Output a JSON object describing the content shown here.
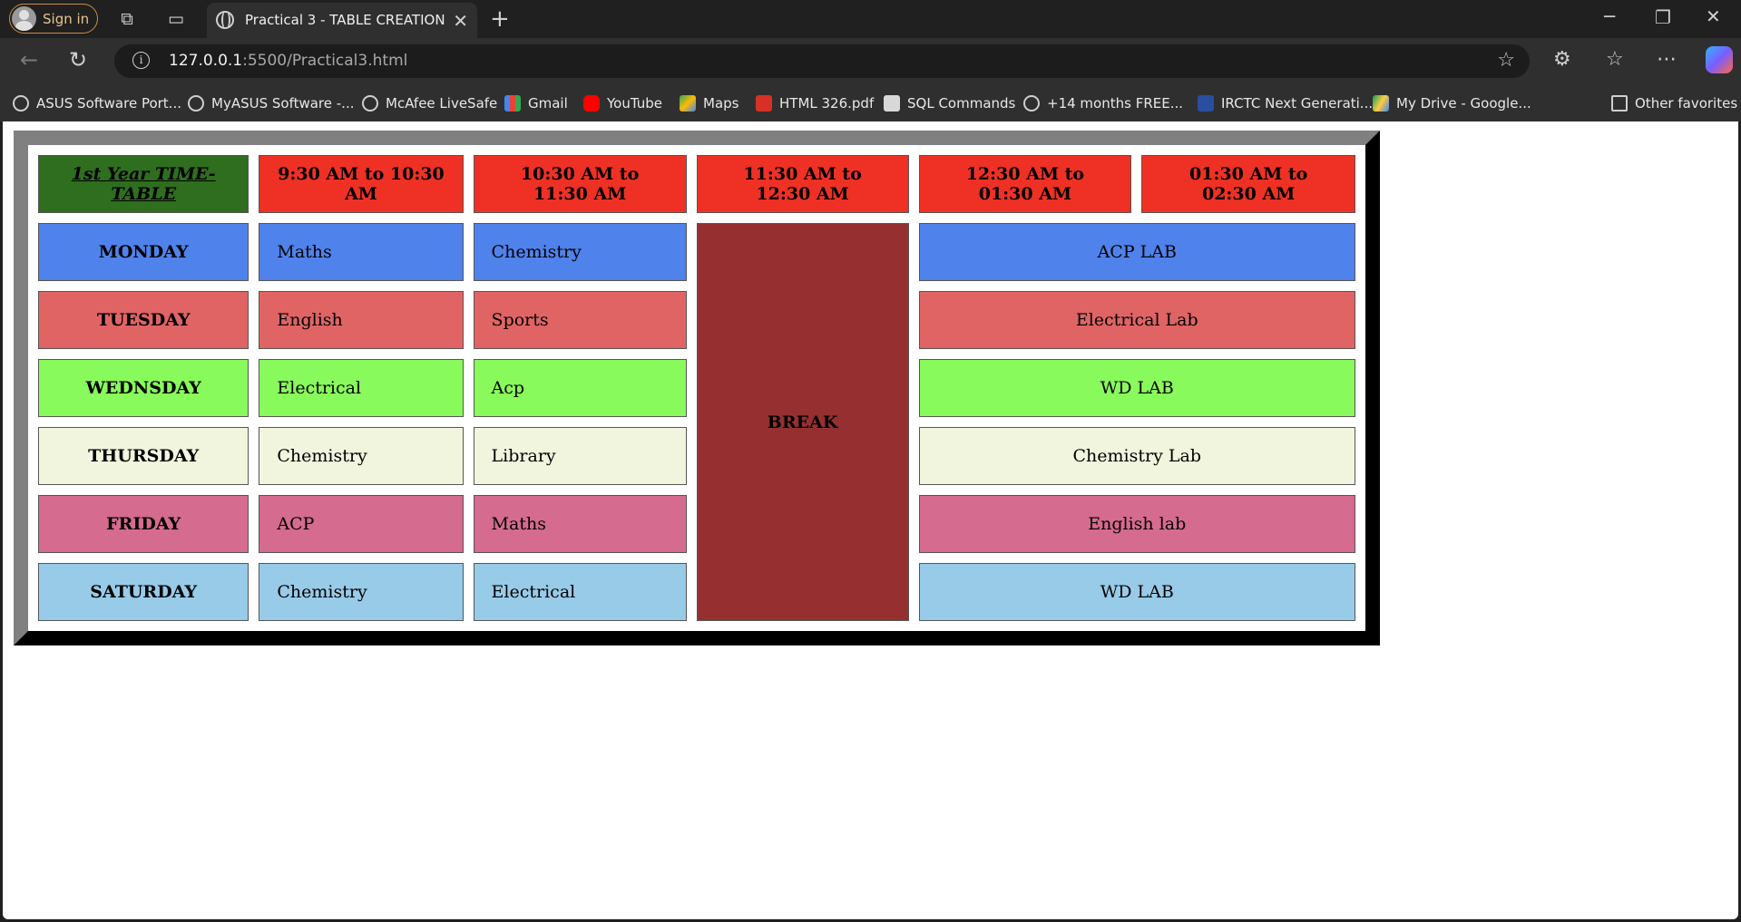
{
  "browser": {
    "signin_label": "Sign in",
    "tab_title": "Practical 3 - TABLE CREATION",
    "url_host": "127.0.0.1",
    "url_rest": ":5500/Practical3.html",
    "bookmarks": [
      {
        "label": "ASUS Software Port...",
        "icon": "globe-icon"
      },
      {
        "label": "MyASUS Software -...",
        "icon": "globe-icon"
      },
      {
        "label": "McAfee LiveSafe",
        "icon": "globe-icon"
      },
      {
        "label": "Gmail",
        "icon": "gmail-icon"
      },
      {
        "label": "YouTube",
        "icon": "youtube-icon"
      },
      {
        "label": "Maps",
        "icon": "maps-icon"
      },
      {
        "label": "HTML 326.pdf",
        "icon": "pdf-icon"
      },
      {
        "label": "SQL Commands",
        "icon": "page-icon"
      },
      {
        "label": "+14 months FREE...",
        "icon": "globe-icon"
      },
      {
        "label": "IRCTC Next Generati...",
        "icon": "irctc-icon"
      },
      {
        "label": "My Drive - Google...",
        "icon": "drive-icon"
      }
    ],
    "other_favorites": "Other favorites"
  },
  "timetable": {
    "corner": "1st Year TIME-TABLE",
    "slots": [
      "9:30 AM to 10:30 AM",
      "10:30 AM to 11:30 AM",
      "11:30 AM to 12:30 AM",
      "12:30 AM to 01:30 AM",
      "01:30 AM to 02:30 AM"
    ],
    "break_label": "BREAK",
    "days": [
      {
        "day": "MONDAY",
        "s1": "Maths",
        "s2": "Chemistry",
        "lab": "ACP LAB"
      },
      {
        "day": "TUESDAY",
        "s1": "English",
        "s2": "Sports",
        "lab": "Electrical Lab"
      },
      {
        "day": "WEDNSDAY",
        "s1": "Electrical",
        "s2": "Acp",
        "lab": "WD LAB"
      },
      {
        "day": "THURSDAY",
        "s1": "Chemistry",
        "s2": "Library",
        "lab": "Chemistry Lab"
      },
      {
        "day": "FRIDAY",
        "s1": "ACP",
        "s2": "Maths",
        "lab": "English lab"
      },
      {
        "day": "SATURDAY",
        "s1": "Chemistry",
        "s2": "Electrical",
        "lab": "WD LAB"
      }
    ],
    "colors": {
      "corner": "#2f6e1f",
      "header": "#ee3124",
      "break": "#963030",
      "rows": [
        "#4f82eb",
        "#e06464",
        "#88fa5b",
        "#f2f5de",
        "#d56b8e",
        "#98cbe8"
      ]
    }
  }
}
